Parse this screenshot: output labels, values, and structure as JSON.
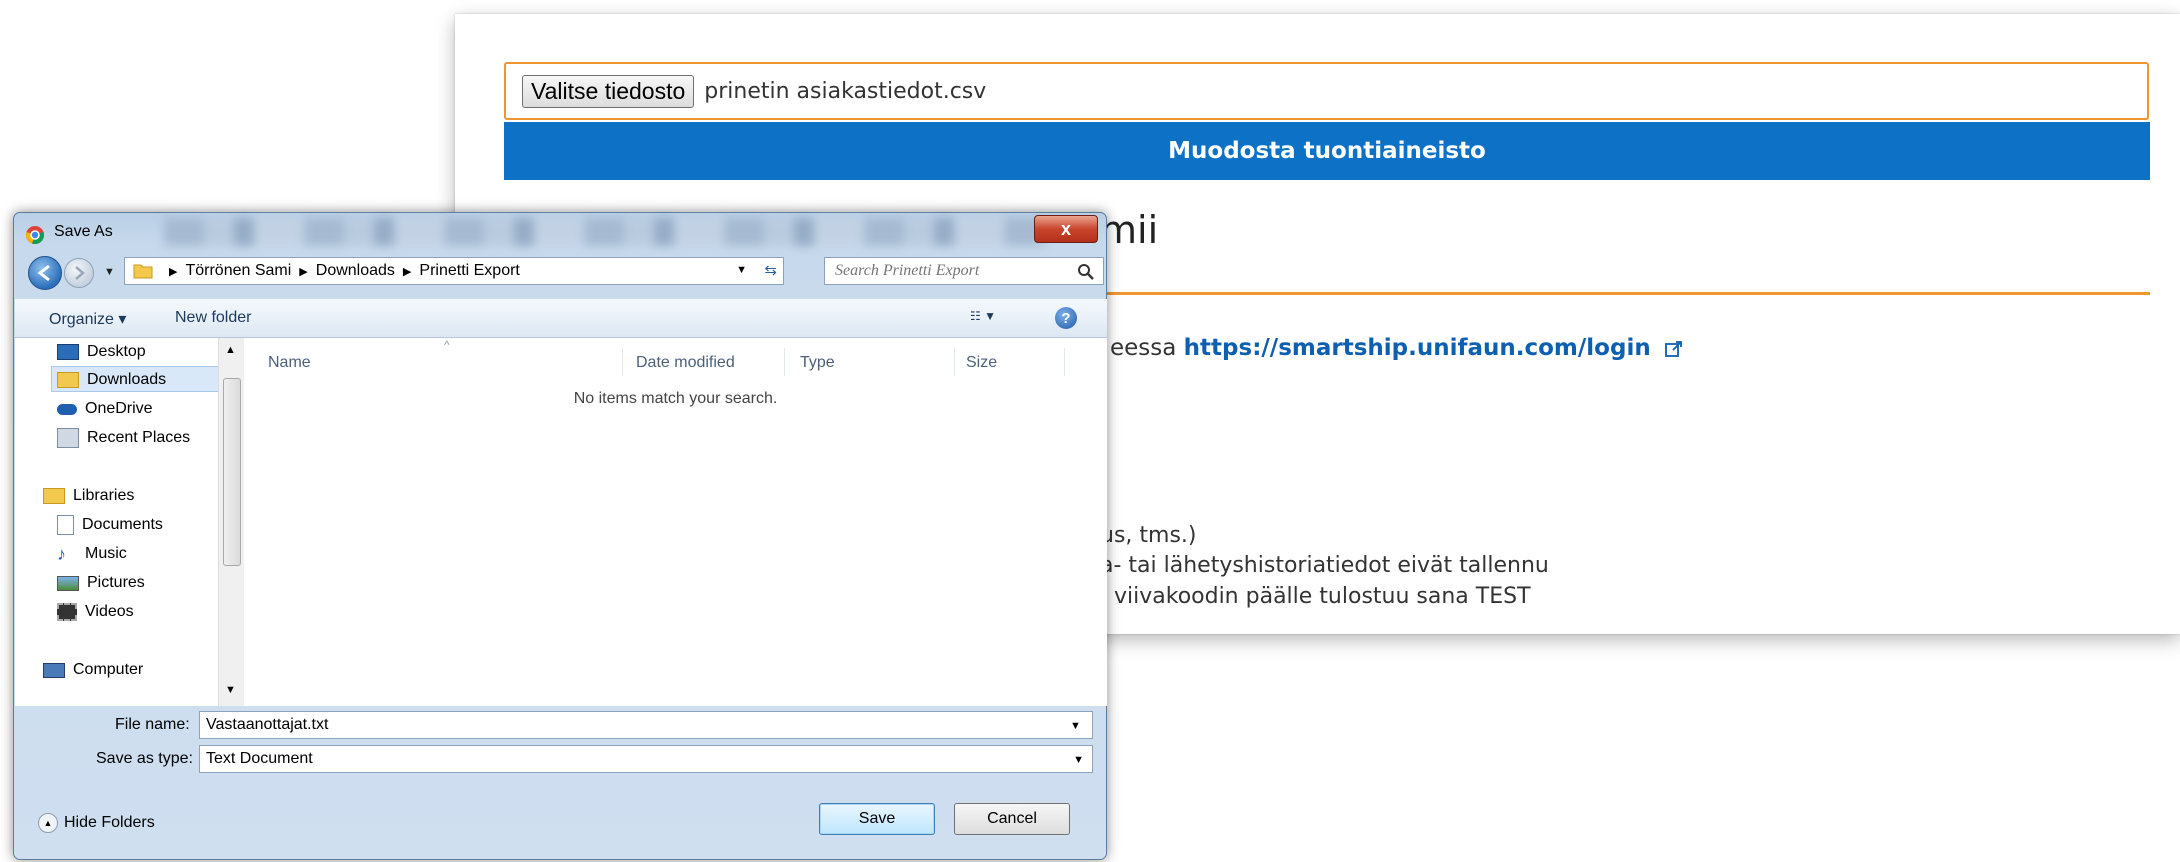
{
  "webpage": {
    "file_button_label": "Valitse tiedosto",
    "chosen_file": "prinetin asiakastiedot.csv",
    "submit_label": "Muodosta tuontiaineisto",
    "heading_fragment": "mii",
    "link_prefix": "eessa ",
    "login_link": "https://smartship.unifaun.com/login",
    "lines": [
      "us, tms.)",
      "a- tai lähetyshistoriatiedot eivät tallennu",
      ", viivakoodin päälle tulostuu sana TEST"
    ],
    "accent_color": "#f0962e",
    "primary_color": "#0d72c6"
  },
  "dialog": {
    "title": "Save As",
    "close_label": "x",
    "breadcrumbs": [
      "Törrönen Sami",
      "Downloads",
      "Prinetti Export"
    ],
    "search_placeholder": "Search Prinetti Export",
    "toolbar": {
      "organize_label": "Organize ▾",
      "new_folder_label": "New folder"
    },
    "nav_items": [
      {
        "label": "Desktop",
        "icon": "desktop-icon"
      },
      {
        "label": "Downloads",
        "icon": "downloads-folder-icon",
        "selected": true
      },
      {
        "label": "OneDrive",
        "icon": "onedrive-icon"
      },
      {
        "label": "Recent Places",
        "icon": "recent-places-icon"
      },
      {
        "label": "Libraries",
        "icon": "libraries-icon"
      },
      {
        "label": "Documents",
        "icon": "documents-icon"
      },
      {
        "label": "Music",
        "icon": "music-icon"
      },
      {
        "label": "Pictures",
        "icon": "pictures-icon"
      },
      {
        "label": "Videos",
        "icon": "videos-icon"
      },
      {
        "label": "Computer",
        "icon": "computer-icon"
      }
    ],
    "columns": [
      "Name",
      "Date modified",
      "Type",
      "Size"
    ],
    "empty_message": "No items match your search.",
    "file_name_label": "File name:",
    "file_name_value": "Vastaanottajat.txt",
    "save_type_label": "Save as type:",
    "save_type_value": "Text Document",
    "hide_folders_label": "Hide Folders",
    "save_label": "Save",
    "cancel_label": "Cancel"
  }
}
